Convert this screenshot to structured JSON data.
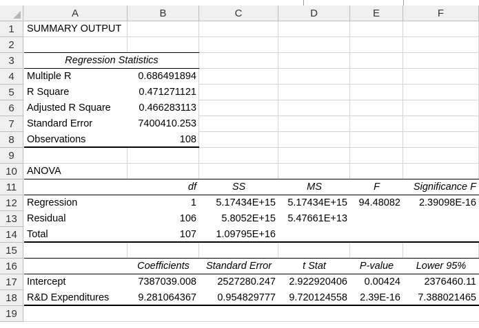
{
  "columns": [
    "A",
    "B",
    "C",
    "D",
    "E",
    "F"
  ],
  "rows": [
    "1",
    "2",
    "3",
    "4",
    "5",
    "6",
    "7",
    "8",
    "9",
    "10",
    "11",
    "12",
    "13",
    "14",
    "15",
    "16",
    "17",
    "18",
    "19"
  ],
  "summary_title": "SUMMARY OUTPUT",
  "regression_statistics": {
    "header": "Regression Statistics",
    "items": [
      {
        "label": "Multiple R",
        "value": "0.686491894"
      },
      {
        "label": "R Square",
        "value": "0.471271121"
      },
      {
        "label": "Adjusted R Square",
        "value": "0.466283113"
      },
      {
        "label": "Standard Error",
        "value": "7400410.253"
      },
      {
        "label": "Observations",
        "value": "108"
      }
    ]
  },
  "anova": {
    "title": "ANOVA",
    "headers": [
      "",
      "df",
      "SS",
      "MS",
      "F",
      "Significance F"
    ],
    "rows": [
      [
        "Regression",
        "1",
        "5.17434E+15",
        "5.17434E+15",
        "94.48082",
        "2.39098E-16"
      ],
      [
        "Residual",
        "106",
        "5.8052E+15",
        "5.47661E+13",
        "",
        ""
      ],
      [
        "Total",
        "107",
        "1.09795E+16",
        "",
        "",
        ""
      ]
    ]
  },
  "coefficients": {
    "headers": [
      "",
      "Coefficients",
      "Standard Error",
      "t Stat",
      "P-value",
      "Lower 95%"
    ],
    "rows": [
      [
        "Intercept",
        "7387039.008",
        "2527280.247",
        "2.922920406",
        "0.00424",
        "2376460.11"
      ],
      [
        "R&D Expenditures",
        "9.281064367",
        "0.954829777",
        "9.720124558",
        "2.39E-16",
        "7.388021465"
      ]
    ]
  }
}
